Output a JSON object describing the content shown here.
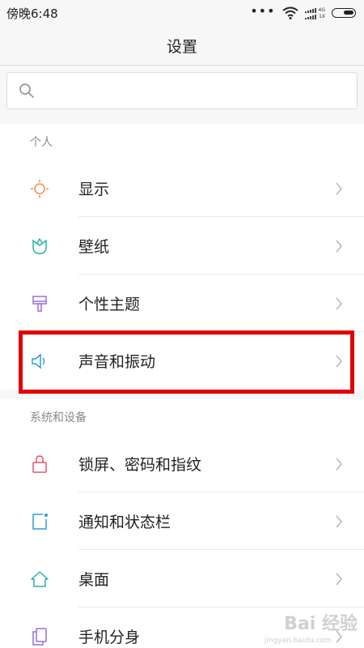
{
  "status_bar": {
    "time": "傍晚6:48",
    "dots": "•••",
    "network_4g": "4G",
    "network_1x": "1X"
  },
  "header": {
    "title": "设置"
  },
  "search": {
    "placeholder": ""
  },
  "sections": [
    {
      "title": "个人",
      "items": [
        {
          "label": "显示",
          "icon": "sun-icon",
          "color": "#f08a4b"
        },
        {
          "label": "壁纸",
          "icon": "tulip-icon",
          "color": "#2bb3a3"
        },
        {
          "label": "个性主题",
          "icon": "brush-icon",
          "color": "#9b6fd6"
        },
        {
          "label": "声音和振动",
          "icon": "speaker-icon",
          "color": "#2a9fd6"
        }
      ]
    },
    {
      "title": "系统和设备",
      "items": [
        {
          "label": "锁屏、密码和指纹",
          "icon": "lock-icon",
          "color": "#e8546a"
        },
        {
          "label": "通知和状态栏",
          "icon": "notification-icon",
          "color": "#2a9fd6"
        },
        {
          "label": "桌面",
          "icon": "home-icon",
          "color": "#2bb3a3"
        },
        {
          "label": "手机分身",
          "icon": "dual-phone-icon",
          "color": "#9b6fd6"
        }
      ]
    }
  ],
  "highlight_color": "#e10000",
  "watermark": {
    "brand": "Bai 经验",
    "url": "jingyan.baidu.com"
  }
}
